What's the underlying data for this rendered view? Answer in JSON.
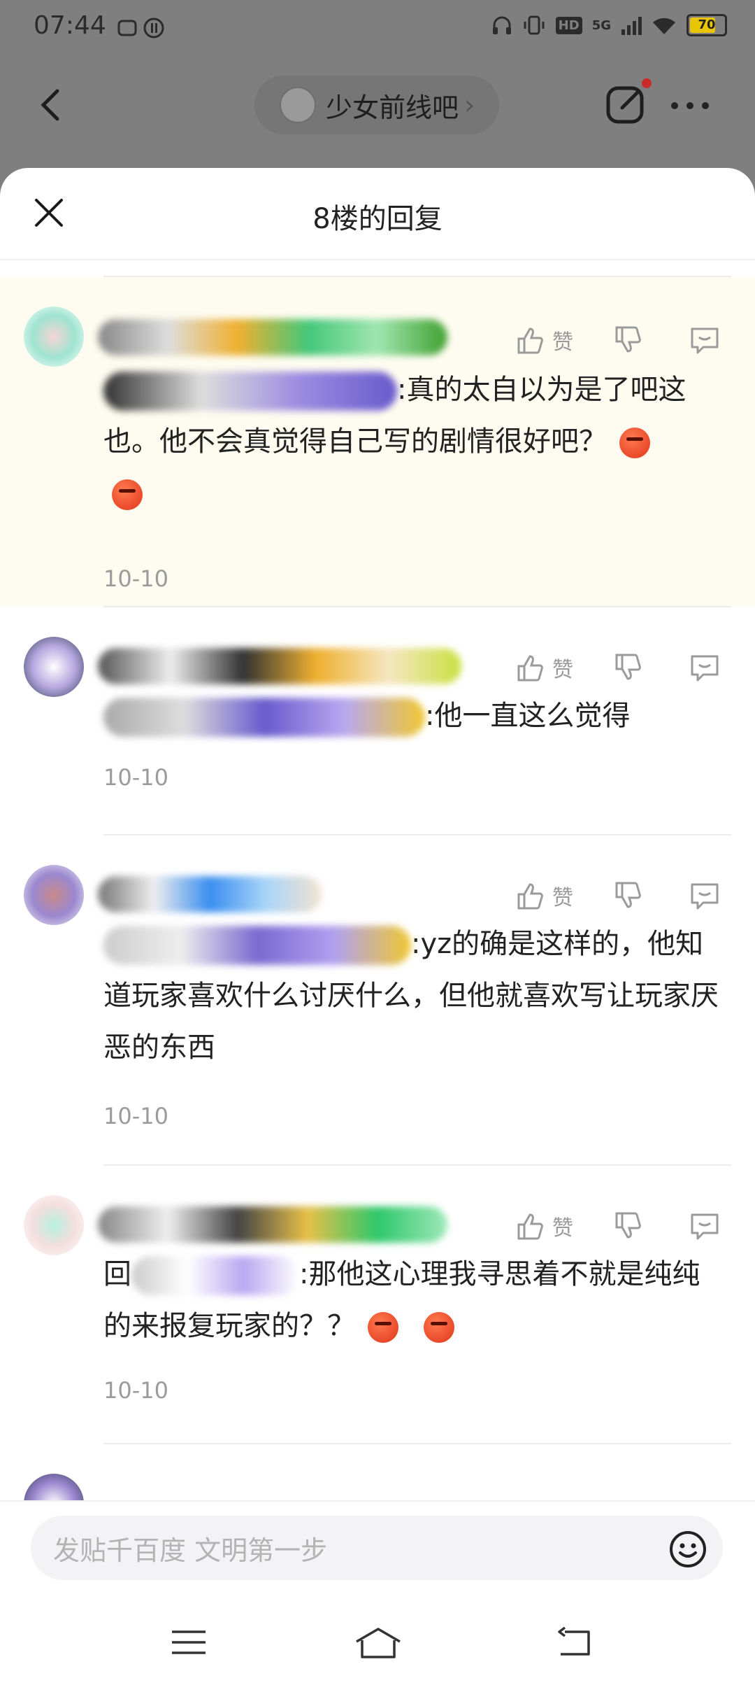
{
  "status_bar": {
    "time": "07:44",
    "network": "5G",
    "battery": "70",
    "battery_level": 0.7,
    "hd_label": "HD"
  },
  "header": {
    "forum_name": "少女前线吧"
  },
  "sheet": {
    "title": "8楼的回复"
  },
  "comments": [
    {
      "prefix": "",
      "text": ":真的太自以为是了吧这也。他不会真觉得自己写的剧情很好吧？",
      "emoji_count": 2,
      "date": "10-10",
      "like_label": "赞",
      "highlighted": true
    },
    {
      "prefix": "",
      "text": ":他一直这么觉得",
      "emoji_count": 0,
      "date": "10-10",
      "like_label": "赞"
    },
    {
      "prefix": "",
      "text": ":yz的确是这样的，他知道玩家喜欢什么讨厌什么，但他就喜欢写让玩家厌恶的东西",
      "emoji_count": 0,
      "date": "10-10",
      "like_label": "赞"
    },
    {
      "prefix": "回",
      "text": ":那他这心理我寻思着不就是纯纯的来报复玩家的？？",
      "emoji_count": 2,
      "date": "10-10",
      "like_label": "赞"
    }
  ],
  "input": {
    "placeholder": "发贴千百度  文明第一步"
  },
  "icons": {
    "back": "chevron-left-icon",
    "edit": "edit-icon",
    "more": "more-icon",
    "close": "close-icon",
    "like": "thumb-up-icon",
    "dislike": "thumb-down-icon",
    "reply": "comment-icon",
    "emoji": "smiley-icon",
    "nav": [
      "menu-icon",
      "home-icon",
      "back-nav-icon"
    ]
  },
  "colors": {
    "overlay": "#7f7f7f",
    "highlight_bg": "#fefcf0",
    "emoji": "#e0341a",
    "red_dot": "#c92a2a",
    "battery": "#e9c400"
  }
}
